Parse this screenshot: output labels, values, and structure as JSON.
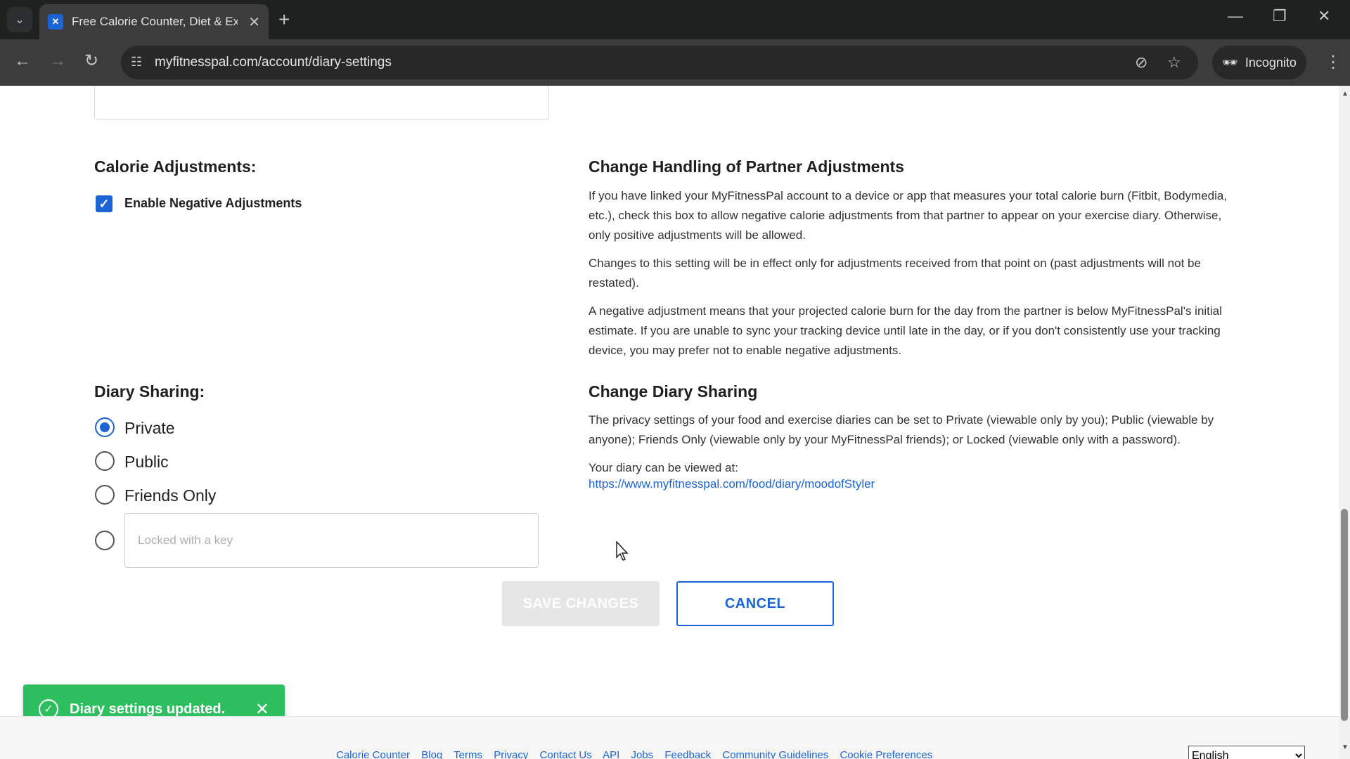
{
  "browser": {
    "tab_title": "Free Calorie Counter, Diet & Exercise",
    "url": "myfitnesspal.com/account/diary-settings",
    "incognito_label": "Incognito"
  },
  "calorie_adjustments": {
    "label": "Calorie Adjustments:",
    "checkbox_label": "Enable Negative Adjustments",
    "checked": true,
    "heading": "Change Handling of Partner Adjustments",
    "paragraphs": [
      "If you have linked your MyFitnessPal account to a device or app that measures your total calorie burn (Fitbit, Bodymedia, etc.), check this box to allow negative calorie adjustments from that partner to appear on your exercise diary. Otherwise, only positive adjustments will be allowed.",
      "Changes to this setting will be in effect only for adjustments received from that point on (past adjustments will not be restated).",
      "A negative adjustment means that your projected calorie burn for the day from the partner is below MyFitnessPal's initial estimate. If you are unable to sync your tracking device until late in the day, or if you don't consistently use your tracking device, you may prefer not to enable negative adjustments."
    ]
  },
  "diary_sharing": {
    "label": "Diary Sharing:",
    "options": [
      "Private",
      "Public",
      "Friends Only"
    ],
    "selected": "Private",
    "locked_placeholder": "Locked with a key",
    "heading": "Change Diary Sharing",
    "description": "The privacy settings of your food and exercise diaries can be set to Private (viewable only by you); Public (viewable by anyone); Friends Only (viewable only by your MyFitnessPal friends); or Locked (viewable only with a password).",
    "viewed_at_label": "Your diary can be viewed at:",
    "diary_url": "https://www.myfitnesspal.com/food/diary/moodofStyler"
  },
  "actions": {
    "save_label": "SAVE CHANGES",
    "cancel_label": "CANCEL"
  },
  "toast": {
    "message": "Diary settings updated."
  },
  "footer": {
    "links": [
      "Calorie Counter",
      "Blog",
      "Terms",
      "Privacy",
      "Contact Us",
      "API",
      "Jobs",
      "Feedback",
      "Community Guidelines",
      "Cookie Preferences"
    ],
    "language": "English"
  },
  "colors": {
    "accent": "#1a64d6",
    "toast_bg": "#2dbe5f"
  }
}
